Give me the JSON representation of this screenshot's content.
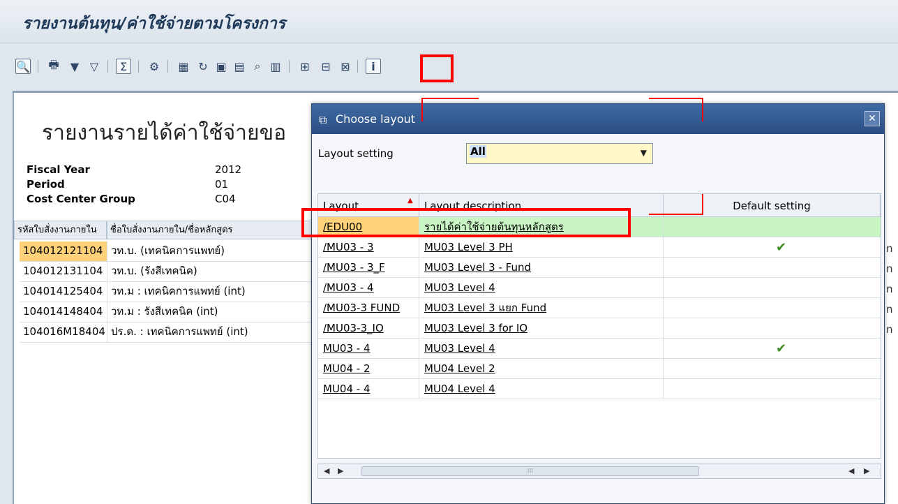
{
  "window": {
    "title": "รายงานต้นทุน/ค่าใช้จ่ายตามโครงการ"
  },
  "toolbar": {
    "icons": [
      "details-icon",
      "print-icon",
      "filter-icon",
      "filter-off-icon",
      "sum-icon",
      "settings-icon",
      "export-icon",
      "refresh-icon",
      "word-icon",
      "spreadsheet-icon",
      "search-icon",
      "chart-icon",
      "layout-grid-icon",
      "choose-layout-icon",
      "save-layout-icon",
      "info-icon"
    ],
    "highlighted": "choose-layout-icon"
  },
  "report": {
    "title": "รายงานรายได้ค่าใช้จ่ายขอ",
    "fiscal_year_label": "Fiscal Year",
    "fiscal_year_value": "2012",
    "period_label": "Period",
    "period_value": "01",
    "cost_center_label": "Cost Center Group",
    "cost_center_value": "C04",
    "columns": [
      "รหัสใบสั่งงานภายใน",
      "ชื่อใบสั่งงานภายใน/ชื่อหลักสูตร"
    ],
    "rows": [
      {
        "code": "104012121104",
        "name": "วท.บ. (เทคนิคการแพทย์)"
      },
      {
        "code": "104012131104",
        "name": "วท.บ. (รังสีเทคนิค)"
      },
      {
        "code": "104014125404",
        "name": "วท.ม : เทคนิคการแพทย์ (int)"
      },
      {
        "code": "104014148404",
        "name": "วท.ม : รังสีเทคนิค (int)"
      },
      {
        "code": "104016M18404",
        "name": "ปร.ด. : เทคนิคการแพทย์ (int)"
      }
    ],
    "right_fragment": "n"
  },
  "dialog": {
    "title": "Choose layout",
    "setting_label": "Layout setting",
    "setting_value": "All",
    "columns": {
      "layout": "Layout",
      "description": "Layout description",
      "default": "Default setting"
    },
    "layouts": [
      {
        "layout": "/EDU00",
        "description": "รายได้ค่าใช้จ่ายต้นทุนหลักสูตร",
        "default": false,
        "selected": true
      },
      {
        "layout": "/MU03 - 3",
        "description": "MU03 Level 3 PH",
        "default": true,
        "selected": false
      },
      {
        "layout": "/MU03 - 3_F",
        "description": "MU03 Level 3 - Fund",
        "default": false,
        "selected": false
      },
      {
        "layout": "/MU03 - 4",
        "description": "MU03 Level 4",
        "default": false,
        "selected": false
      },
      {
        "layout": "/MU03-3 FUND",
        "description": "MU03 Level 3 แยก Fund",
        "default": false,
        "selected": false
      },
      {
        "layout": "/MU03-3_IO",
        "description": "MU03 Level 3 for IO",
        "default": false,
        "selected": false
      },
      {
        "layout": "MU03 - 4",
        "description": "MU03 Level 4",
        "default": true,
        "selected": false
      },
      {
        "layout": "MU04 - 2",
        "description": "MU04 Level 2",
        "default": false,
        "selected": false
      },
      {
        "layout": "MU04 - 4",
        "description": "MU04 Level 4",
        "default": false,
        "selected": false
      }
    ],
    "checkmark": "✔",
    "scroll_thumb": "⁞⁞⁞"
  },
  "colors": {
    "highlight": "#ff0000",
    "selected_row": "#c9f5c4",
    "selected_cell": "#ffd27a",
    "dialog_title": "#2a4f84"
  }
}
